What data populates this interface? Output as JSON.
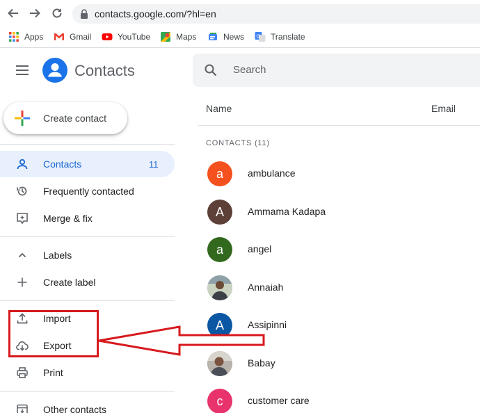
{
  "browser": {
    "url": "contacts.google.com/?hl=en",
    "icons": [
      "back-icon",
      "forward-icon",
      "reload-icon",
      "lock-icon"
    ],
    "bookmarks": [
      {
        "label": "Apps",
        "icon": "apps-grid-icon"
      },
      {
        "label": "Gmail",
        "icon": "gmail-icon"
      },
      {
        "label": "YouTube",
        "icon": "youtube-icon"
      },
      {
        "label": "Maps",
        "icon": "maps-icon"
      },
      {
        "label": "News",
        "icon": "news-icon"
      },
      {
        "label": "Translate",
        "icon": "translate-icon"
      }
    ]
  },
  "app": {
    "title": "Contacts",
    "search_placeholder": "Search",
    "create_label": "Create contact"
  },
  "sidebar": {
    "items": [
      {
        "label": "Contacts",
        "count": "11",
        "icon": "person-icon",
        "active": true
      },
      {
        "label": "Frequently contacted",
        "icon": "history-icon"
      },
      {
        "label": "Merge & fix",
        "icon": "merge-fix-icon"
      },
      {
        "label": "Labels",
        "icon": "chevron-up-icon"
      },
      {
        "label": "Create label",
        "icon": "plus-icon"
      },
      {
        "label": "Import",
        "icon": "upload-icon"
      },
      {
        "label": "Export",
        "icon": "cloud-download-icon"
      },
      {
        "label": "Print",
        "icon": "printer-icon"
      },
      {
        "label": "Other contacts",
        "icon": "archive-icon"
      }
    ]
  },
  "list": {
    "columns": {
      "name": "Name",
      "email": "Email"
    },
    "section_header": "CONTACTS (11)",
    "contacts": [
      {
        "name": "ambulance",
        "initial": "a",
        "color": "#f4511e"
      },
      {
        "name": "Ammama Kadapa",
        "initial": "A",
        "color": "#5d4037"
      },
      {
        "name": "angel",
        "initial": "a",
        "color": "#33691e"
      },
      {
        "name": "Annaiah",
        "initial": "",
        "photo": true
      },
      {
        "name": "Assipinni",
        "initial": "A",
        "color": "#0b57a4"
      },
      {
        "name": "Babay",
        "initial": "",
        "photo": true
      },
      {
        "name": "customer care",
        "initial": "c",
        "color": "#e8336d"
      }
    ]
  },
  "colors": {
    "accent": "#1967d2",
    "active_bg": "#e8f0fe",
    "annotation": "#d7191c"
  }
}
